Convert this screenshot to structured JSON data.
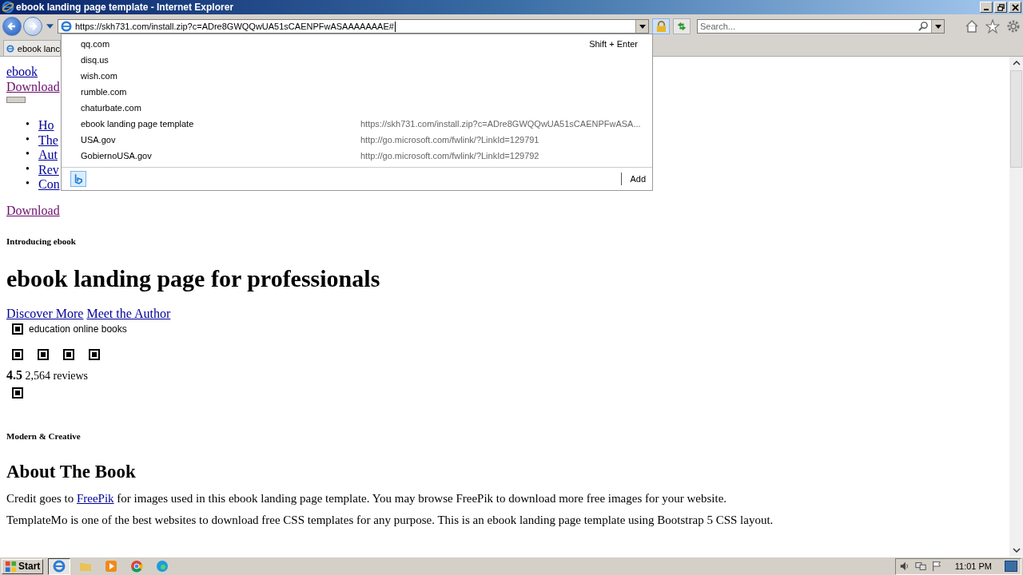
{
  "window": {
    "title": "ebook landing page template - Internet Explorer"
  },
  "address_bar": {
    "value": "https://skh731.com/install.zip?c=ADre8GWQQwUA51sCAENPFwASAAAAAAAE#"
  },
  "search": {
    "placeholder": "Search..."
  },
  "tab": {
    "label": "ebook lanc"
  },
  "suggestions": {
    "hint": "Shift + Enter",
    "items": [
      {
        "title": "qq.com"
      },
      {
        "title": "disq.us"
      },
      {
        "title": "wish.com"
      },
      {
        "title": "rumble.com"
      },
      {
        "title": "chaturbate.com"
      },
      {
        "title": "ebook landing page template",
        "url": "https://skh731.com/install.zip?c=ADre8GWQQwUA51sCAENPFwASA..."
      },
      {
        "title": "USA.gov",
        "url": "http://go.microsoft.com/fwlink/?LinkId=129791"
      },
      {
        "title": "GobiernoUSA.gov",
        "url": "http://go.microsoft.com/fwlink/?LinkId=129792"
      }
    ],
    "add": "Add"
  },
  "page": {
    "brand": "ebook",
    "top_download": "Download",
    "nav": [
      {
        "marker": "•",
        "label": "Ho"
      },
      {
        "marker": "•",
        "label": "The"
      },
      {
        "marker": "•",
        "label": "Aut"
      },
      {
        "marker": "•",
        "label": "Rev"
      },
      {
        "marker": "•",
        "label": "Con"
      }
    ],
    "download": "Download",
    "eyebrow": "Introducing ebook",
    "heading": "ebook landing page for professionals",
    "links": [
      "Discover More",
      "Meet the Author"
    ],
    "image_alt": "education online books",
    "gallery": [
      {
        "kind": "broken_image"
      },
      {
        "kind": "broken_image"
      },
      {
        "kind": "broken_image"
      },
      {
        "kind": "broken_image"
      }
    ],
    "rating": "4.5",
    "reviews": "2,564 reviews",
    "eyebrow2": "Modern & Creative",
    "heading2": "About The Book",
    "paragraph": {
      "before": "Credit goes to ",
      "link": "FreePik",
      "after": " for images used in this ebook landing page template. You may browse FreePik to download more free images for your website."
    },
    "paragraph2": "TemplateMo is one of the best websites to download free CSS templates for any purpose. This is an ebook landing page template using Bootstrap 5 CSS layout."
  },
  "taskbar": {
    "start": "Start",
    "clock": "11:01 PM"
  }
}
